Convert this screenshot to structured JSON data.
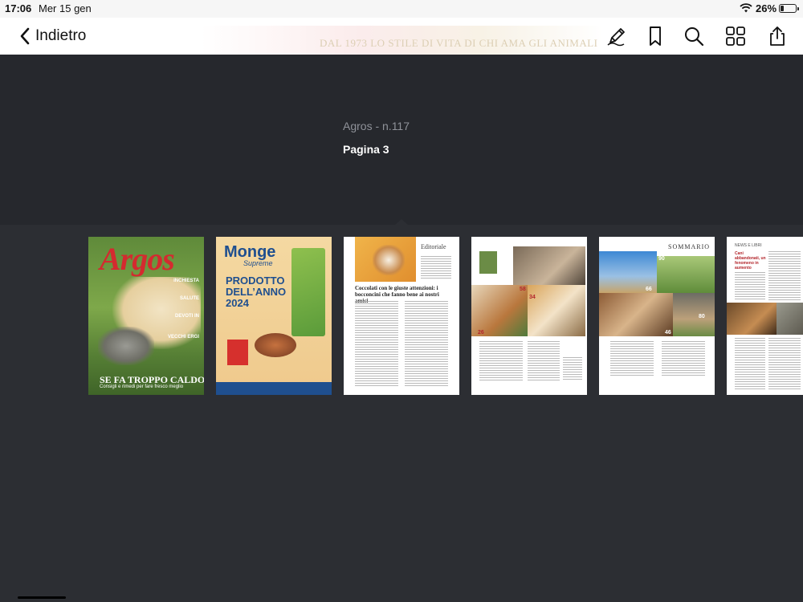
{
  "status_bar": {
    "time": "17:06",
    "date": "Mer 15 gen",
    "battery_percent": "26%",
    "battery_level": 0.26
  },
  "toolbar": {
    "back_label": "Indietro",
    "icons": [
      "annotate-pencil-icon",
      "bookmark-icon",
      "search-icon",
      "grid-view-icon",
      "share-icon"
    ],
    "banner_text": "DAL 1973 LO STILE DI VITA DI CHI AMA GLI ANIMALI"
  },
  "info": {
    "publication": "Agros - n.117",
    "page": "Pagina 3"
  },
  "thumbnails": [
    {
      "id": "cover",
      "masthead": "Argos",
      "side_texts": [
        "INCHIESTA",
        "SALUTE",
        "DEVOTI IN",
        "VECCHI ERGI"
      ],
      "cta": "SE FA TROPPO CALDO",
      "cta_sub": "Consigli e rimedi per fare fresco meglio"
    },
    {
      "id": "monge-ad",
      "brand": "Monge",
      "sub_brand": "Supreme",
      "headline": "PRODOTTO DELL’ANNO 2024"
    },
    {
      "id": "editoriale",
      "header": "Editoriale",
      "title": "Coccolati con le giuste attenzioni: i bocconcini che fanno bene ai nostri amici",
      "selected": true
    },
    {
      "id": "pagina-4",
      "numbers": [
        "58",
        "34",
        "26"
      ]
    },
    {
      "id": "sommario",
      "title": "SOMMARIO",
      "numbers": [
        "90",
        "66",
        "46",
        "80"
      ]
    },
    {
      "id": "news",
      "header": "NEWS E LIBRI",
      "red_title": "Cani abbandonati, un fenomeno in aumento"
    }
  ]
}
